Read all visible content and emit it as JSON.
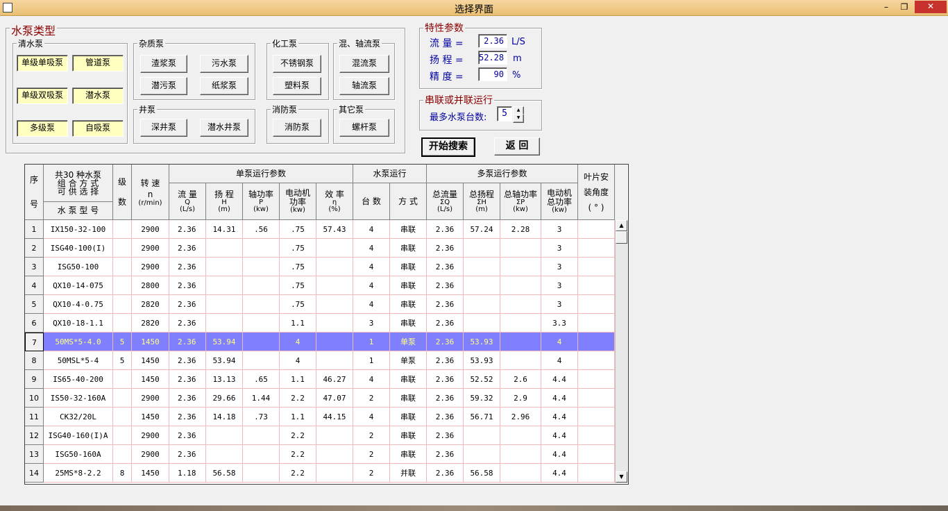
{
  "window": {
    "title": "选择界面",
    "min_icon": "minimize-icon",
    "max_icon": "maximize-icon",
    "close_icon": "close-icon"
  },
  "pump_type": {
    "legend": "水泵类型",
    "groups": {
      "clear": {
        "legend": "清水泵",
        "buttons": [
          "单级单吸泵",
          "管道泵",
          "单级双吸泵",
          "潜水泵",
          "多级泵",
          "自吸泵"
        ]
      },
      "impurity": {
        "legend": "杂质泵",
        "buttons": [
          "渣浆泵",
          "污水泵",
          "潜污泵",
          "纸浆泵"
        ]
      },
      "chemical": {
        "legend": "化工泵",
        "buttons": [
          "不锈钢泵",
          "塑料泵"
        ]
      },
      "mixed": {
        "legend": "混、轴流泵",
        "buttons": [
          "混流泵",
          "轴流泵"
        ]
      },
      "well": {
        "legend": "井泵",
        "buttons": [
          "深井泵",
          "潜水井泵"
        ]
      },
      "fire": {
        "legend": "消防泵",
        "buttons": [
          "消防泵"
        ]
      },
      "other": {
        "legend": "其它泵",
        "buttons": [
          "螺杆泵"
        ]
      }
    }
  },
  "params": {
    "legend": "特性参数",
    "flow": {
      "label": "流  量 =",
      "value": "2.36",
      "unit": "L/S"
    },
    "head": {
      "label": "扬  程 =",
      "value": "52.28",
      "unit": "m"
    },
    "precision": {
      "label": "精  度 =",
      "value": "90",
      "unit": "%"
    }
  },
  "series": {
    "legend": "串联或并联运行",
    "label": "最多水泵台数:",
    "value": "5"
  },
  "actions": {
    "search": "开始搜索",
    "back": "返  回"
  },
  "table": {
    "headers": {
      "seq": [
        "序",
        "号"
      ],
      "combo_line1": "共30 种水泵",
      "combo_line2": "组 合 方 式",
      "combo_line3": "可 供 选 择",
      "model": "水 泵 型 号",
      "stage": [
        "级",
        "数"
      ],
      "speed": [
        "转  速",
        "n",
        "(r/min)"
      ],
      "single_group": "单泵运行参数",
      "single": [
        [
          "流  量",
          "Q",
          "(L/s)"
        ],
        [
          "扬  程",
          "H",
          "(m)"
        ],
        [
          "轴功率",
          "P",
          "(kw)"
        ],
        [
          "电动机",
          "功率",
          "(kw)"
        ],
        [
          "效  率",
          "η",
          "(%)"
        ]
      ],
      "pump_run_group": "水泵运行",
      "count": "台  数",
      "mode": "方  式",
      "multi_group": "多泵运行参数",
      "multi": [
        [
          "总流量",
          "ΣQ",
          "(L/s)"
        ],
        [
          "总扬程",
          "ΣH",
          "(m)"
        ],
        [
          "总轴功率",
          "ΣP",
          "(kw)"
        ],
        [
          "电动机",
          "总功率",
          "(kw)"
        ]
      ],
      "blade": [
        "叶片安",
        "装角度",
        "( ° )"
      ]
    },
    "rows": [
      [
        "1",
        "IX150-32-100",
        "",
        "2900",
        "2.36",
        "14.31",
        ".56",
        ".75",
        "57.43",
        "4",
        "串联",
        "2.36",
        "57.24",
        "2.28",
        "3",
        ""
      ],
      [
        "2",
        "ISG40-100(I)",
        "",
        "2900",
        "2.36",
        "",
        "",
        ".75",
        "",
        "4",
        "串联",
        "2.36",
        "",
        "",
        "3",
        ""
      ],
      [
        "3",
        "ISG50-100",
        "",
        "2900",
        "2.36",
        "",
        "",
        ".75",
        "",
        "4",
        "串联",
        "2.36",
        "",
        "",
        "3",
        ""
      ],
      [
        "4",
        "QX10-14-075",
        "",
        "2800",
        "2.36",
        "",
        "",
        ".75",
        "",
        "4",
        "串联",
        "2.36",
        "",
        "",
        "3",
        ""
      ],
      [
        "5",
        "QX10-4-0.75",
        "",
        "2820",
        "2.36",
        "",
        "",
        ".75",
        "",
        "4",
        "串联",
        "2.36",
        "",
        "",
        "3",
        ""
      ],
      [
        "6",
        "QX10-18-1.1",
        "",
        "2820",
        "2.36",
        "",
        "",
        "1.1",
        "",
        "3",
        "串联",
        "2.36",
        "",
        "",
        "3.3",
        ""
      ],
      [
        "7",
        "50MS*5-4.0",
        "5",
        "1450",
        "2.36",
        "53.94",
        "",
        "4",
        "",
        "1",
        "单泵",
        "2.36",
        "53.93",
        "",
        "4",
        ""
      ],
      [
        "8",
        "50MSL*5-4",
        "5",
        "1450",
        "2.36",
        "53.94",
        "",
        "4",
        "",
        "1",
        "单泵",
        "2.36",
        "53.93",
        "",
        "4",
        ""
      ],
      [
        "9",
        "IS65-40-200",
        "",
        "1450",
        "2.36",
        "13.13",
        ".65",
        "1.1",
        "46.27",
        "4",
        "串联",
        "2.36",
        "52.52",
        "2.6",
        "4.4",
        ""
      ],
      [
        "10",
        "IS50-32-160A",
        "",
        "2900",
        "2.36",
        "29.66",
        "1.44",
        "2.2",
        "47.07",
        "2",
        "串联",
        "2.36",
        "59.32",
        "2.9",
        "4.4",
        ""
      ],
      [
        "11",
        "CK32/20L",
        "",
        "1450",
        "2.36",
        "14.18",
        ".73",
        "1.1",
        "44.15",
        "4",
        "串联",
        "2.36",
        "56.71",
        "2.96",
        "4.4",
        ""
      ],
      [
        "12",
        "ISG40-160(I)A",
        "",
        "2900",
        "2.36",
        "",
        "",
        "2.2",
        "",
        "2",
        "串联",
        "2.36",
        "",
        "",
        "4.4",
        ""
      ],
      [
        "13",
        "ISG50-160A",
        "",
        "2900",
        "2.36",
        "",
        "",
        "2.2",
        "",
        "2",
        "串联",
        "2.36",
        "",
        "",
        "4.4",
        ""
      ],
      [
        "14",
        "25MS*8-2.2",
        "8",
        "1450",
        "1.18",
        "56.58",
        "",
        "2.2",
        "",
        "2",
        "并联",
        "2.36",
        "56.58",
        "",
        "4.4",
        ""
      ]
    ],
    "selected_row": 7
  },
  "colors": {
    "selection_bg": "#8080ff",
    "selection_fg": "#ffff80",
    "accent_label": "#0000a0",
    "legend_red": "#8b0000"
  }
}
